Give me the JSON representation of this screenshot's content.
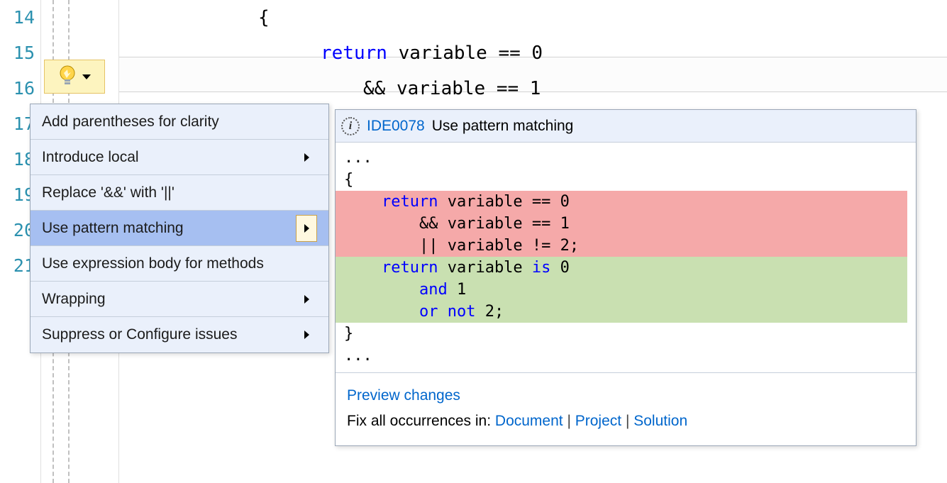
{
  "editor": {
    "line_numbers": [
      "14",
      "15",
      "16",
      "17",
      "18",
      "19",
      "20",
      "21"
    ],
    "code": {
      "l14": "{",
      "l15_kw": "return",
      "l15_rest": " variable == 0",
      "l16": "&& variable == 1"
    }
  },
  "lightbulb": {
    "name": "quick-actions"
  },
  "menu": {
    "items": [
      {
        "label": "Add parentheses for clarity",
        "submenu": false
      },
      {
        "label": "Introduce local",
        "submenu": true
      },
      {
        "label": "Replace '&&' with '||'",
        "submenu": false
      },
      {
        "label": "Use pattern matching",
        "submenu": true,
        "highlighted": true
      },
      {
        "label": "Use expression body for methods",
        "submenu": false
      },
      {
        "label": "Wrapping",
        "submenu": true
      },
      {
        "label": "Suppress or Configure issues",
        "submenu": true
      }
    ]
  },
  "preview": {
    "rule_id": "IDE0078",
    "rule_text": "Use pattern matching",
    "body": {
      "ellipsis_top": "...",
      "brace_open": "{",
      "removed": {
        "l1_indent": "    ",
        "l1_kw": "return",
        "l1_rest": " variable == 0",
        "l2": "        && variable == 1",
        "l3": "        || variable != 2;"
      },
      "added": {
        "l1_indent": "    ",
        "l1_kw": "return",
        "l1_mid": " variable ",
        "l1_is": "is",
        "l1_end": " 0",
        "l2_indent": "        ",
        "l2_and": "and",
        "l2_end": " 1",
        "l3_indent": "        ",
        "l3_or": "or",
        "l3_sp": " ",
        "l3_not": "not",
        "l3_end": " 2;"
      },
      "brace_close": "}",
      "ellipsis_bottom": "..."
    },
    "footer": {
      "preview_link": "Preview changes",
      "fix_prefix": "Fix all occurrences in: ",
      "document": "Document",
      "project": "Project",
      "solution": "Solution",
      "sep": " | "
    }
  }
}
